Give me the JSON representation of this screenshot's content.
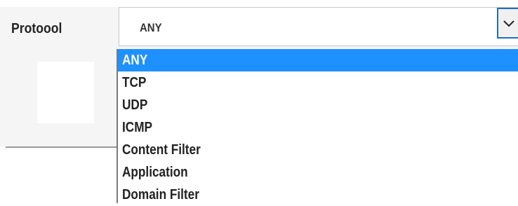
{
  "field": {
    "label": "Protoool",
    "selected_value": "ANY"
  },
  "dropdown": {
    "options": [
      "ANY",
      "TCP",
      "UDP",
      "ICMP",
      "Content Filter",
      "Application",
      "Domain Filter"
    ],
    "highlighted_index": 0
  },
  "icons": {
    "select_arrow": "chevron-down-icon"
  },
  "colors": {
    "highlight": "#1e90ff",
    "focus_border": "#1f6fbf"
  }
}
